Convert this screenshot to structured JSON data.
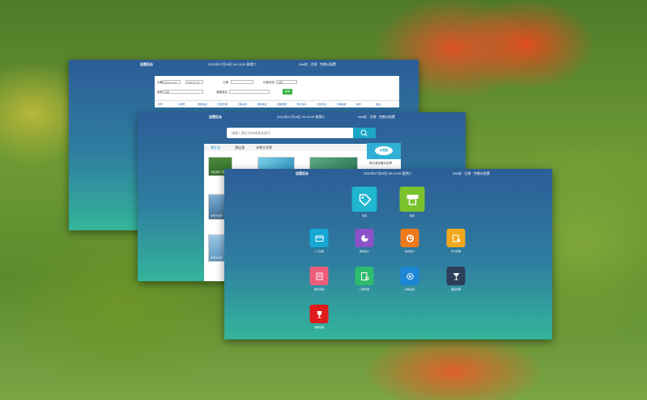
{
  "colors": {
    "accent_green": "#3cb548",
    "accent_cyan": "#1aa7c6",
    "header_blue": "#2c5d97",
    "footer_teal": "#34b59a"
  },
  "window_back": {
    "title": "运营后台",
    "datetime": "2021年07月26日 09:10:30 星期二",
    "user": "Wel欢 · 注销 · 完善分配置",
    "form": {
      "row1": {
        "label_date": "日期",
        "date_from": "2021-07-26",
        "date_to": "2021-07-26",
        "label_order": "订单",
        "label_status": "付款状态",
        "status_value": "全部"
      },
      "row2": {
        "label_type": "类型",
        "type_value": "全部",
        "label_name": "游客姓名",
        "query_button": "查询"
      }
    },
    "columns": [
      "序号",
      "订单号",
      "游客姓名",
      "出游日期",
      "门票名称",
      "游客电话",
      "游客数量",
      "预订时间",
      "付款状态",
      "订单金额",
      "操作",
      "备注"
    ]
  },
  "window_middle": {
    "title": "运营后台",
    "datetime": "2021年07月26日 09:10:30 星期二",
    "user": "Wel欢 · 注销 · 完善分配置",
    "search_placeholder": "请输入景区名称或者关键字",
    "tabs": [
      "景区游",
      "酒店游",
      "冰雪大世界"
    ],
    "thumbs": [
      {
        "label": "景区游乐门票"
      },
      {
        "label": ""
      },
      {
        "label": ""
      },
      {
        "label": "冰雪大世界"
      },
      {
        "label": "冰雪大世界"
      }
    ],
    "side_card": {
      "logo": "冰雪游",
      "label": "哈尔滨冰雪大世界"
    }
  },
  "window_front": {
    "title": "运营后台",
    "datetime": "2021年07月26日 09:10:30 星期二",
    "user": "Wel欢 · 注销 · 完善分配置",
    "apps": [
      {
        "label": "售票",
        "icon": "tag-icon",
        "color": "#1fb6cf"
      },
      {
        "label": "检票",
        "icon": "ticket-machine-icon",
        "color": "#7cc22f"
      },
      {
        "label": "人工售票",
        "icon": "wallet-icon",
        "color": "#17a8d6"
      },
      {
        "label": "销售统计",
        "icon": "pie-chart-icon",
        "color": "#8b52c9"
      },
      {
        "label": "财务统计",
        "icon": "donut-chart-icon",
        "color": "#ee7a1c"
      },
      {
        "label": "年卡管理",
        "icon": "card-settings-icon",
        "color": "#f2a81d"
      },
      {
        "label": "团队管理",
        "icon": "document-icon",
        "color": "#ee5d7a"
      },
      {
        "label": "订单管理",
        "icon": "order-settings-icon",
        "color": "#2fbb6e"
      },
      {
        "label": "系统设置",
        "icon": "gear-icon",
        "color": "#1b86d4"
      },
      {
        "label": "酒店管理",
        "icon": "cocktail-icon",
        "color": "#2d3f5a"
      },
      {
        "label": "酒吧管理",
        "icon": "wine-glass-icon",
        "color": "#e01b1b"
      }
    ]
  }
}
